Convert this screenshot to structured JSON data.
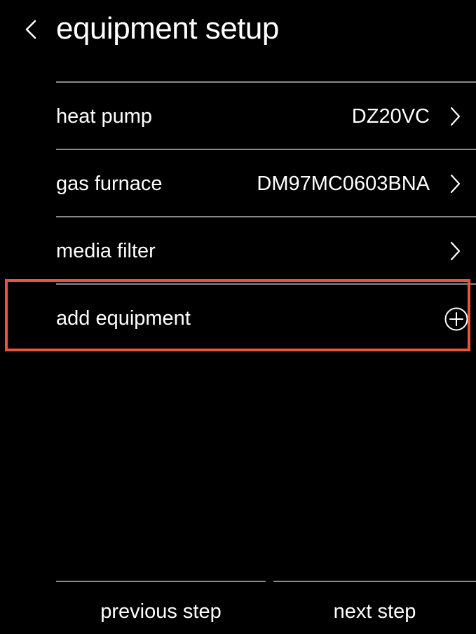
{
  "header": {
    "back_icon": "chevron-left-icon",
    "title": "equipment setup"
  },
  "equipment_list": [
    {
      "label": "heat pump",
      "value": "DZ20VC",
      "icon": "chevron-right-icon"
    },
    {
      "label": "gas furnace",
      "value": "DM97MC0603BNA",
      "icon": "chevron-right-icon"
    },
    {
      "label": "media filter",
      "value": "",
      "icon": "chevron-right-icon"
    }
  ],
  "add_equipment": {
    "label": "add equipment",
    "icon": "plus-circle-icon",
    "highlighted": true
  },
  "footer": {
    "previous_label": "previous step",
    "next_label": "next step"
  },
  "colors": {
    "background": "#000000",
    "text": "#ffffff",
    "divider": "#8a8a8a",
    "highlight": "#e8553b"
  }
}
